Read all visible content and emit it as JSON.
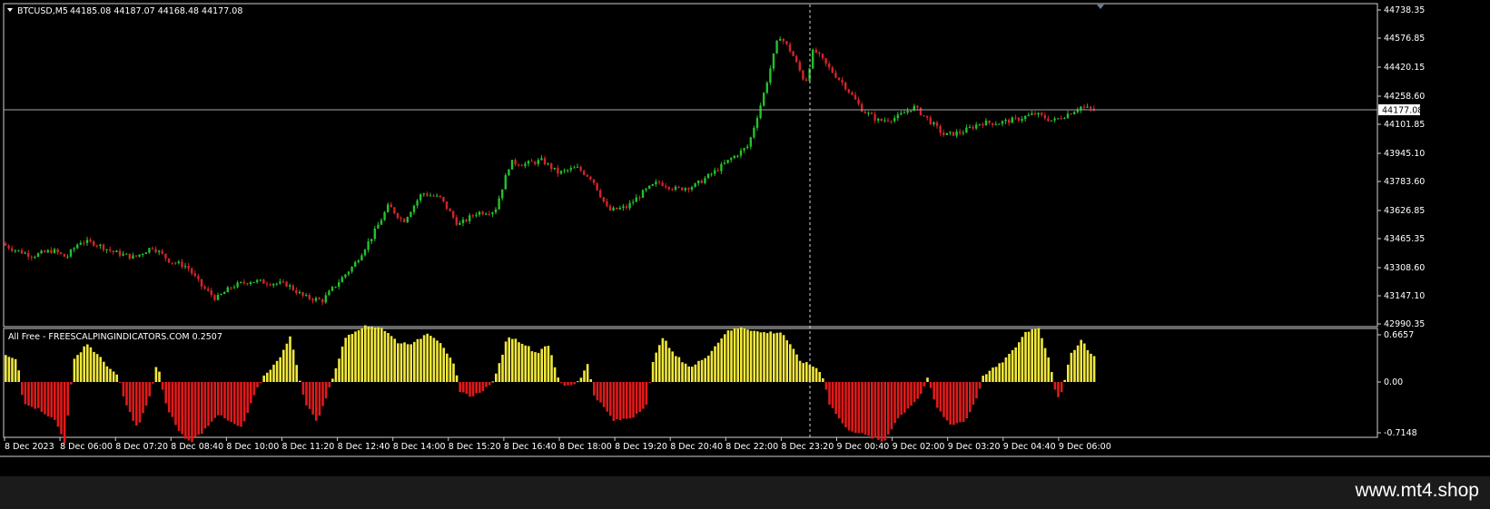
{
  "symbol_header": {
    "symbol": "BTCUSD,M5",
    "ohlc": "44185.08 44187.07 44168.48 44177.08"
  },
  "price_axis": {
    "ticks": [
      "44738.35",
      "44576.85",
      "44420.15",
      "44258.60",
      "44101.85",
      "43945.10",
      "43783.60",
      "43626.85",
      "43465.35",
      "43308.60",
      "43147.10",
      "42990.35"
    ],
    "current_price": "44177.08"
  },
  "indicator": {
    "title": "All Free - FREESCALPINGINDICATORS.COM 0.2507",
    "axis_ticks": [
      "0.6657",
      "0.00",
      "-0.7148"
    ]
  },
  "time_axis": {
    "labels": [
      "8 Dec 2023",
      "8 Dec 06:00",
      "8 Dec 07:20",
      "8 Dec 08:40",
      "8 Dec 10:00",
      "8 Dec 11:20",
      "8 Dec 12:40",
      "8 Dec 14:00",
      "8 Dec 15:20",
      "8 Dec 16:40",
      "8 Dec 18:00",
      "8 Dec 19:20",
      "8 Dec 20:40",
      "8 Dec 22:00",
      "8 Dec 23:20",
      "9 Dec 00:40",
      "9 Dec 02:00",
      "9 Dec 03:20",
      "9 Dec 04:40",
      "9 Dec 06:00"
    ]
  },
  "colors": {
    "bull": "#22c22a",
    "bear": "#d4232a",
    "hist_pos": "#f2e83a",
    "hist_neg": "#e01a1a",
    "axis": "#cfcfcf"
  },
  "price_path_anchors": [
    [
      0,
      43440
    ],
    [
      18,
      43400
    ],
    [
      36,
      43370
    ],
    [
      58,
      43400
    ],
    [
      73,
      43360
    ],
    [
      88,
      43450
    ],
    [
      104,
      43440
    ],
    [
      125,
      43390
    ],
    [
      148,
      43360
    ],
    [
      168,
      43420
    ],
    [
      187,
      43340
    ],
    [
      206,
      43310
    ],
    [
      222,
      43200
    ],
    [
      238,
      43130
    ],
    [
      256,
      43200
    ],
    [
      276,
      43230
    ],
    [
      296,
      43220
    ],
    [
      316,
      43210
    ],
    [
      335,
      43140
    ],
    [
      355,
      43120
    ],
    [
      372,
      43220
    ],
    [
      390,
      43320
    ],
    [
      410,
      43480
    ],
    [
      428,
      43650
    ],
    [
      444,
      43560
    ],
    [
      465,
      43720
    ],
    [
      485,
      43690
    ],
    [
      505,
      43540
    ],
    [
      525,
      43610
    ],
    [
      545,
      43620
    ],
    [
      562,
      43890
    ],
    [
      578,
      43880
    ],
    [
      597,
      43900
    ],
    [
      615,
      43830
    ],
    [
      635,
      43860
    ],
    [
      652,
      43800
    ],
    [
      670,
      43620
    ],
    [
      690,
      43640
    ],
    [
      710,
      43730
    ],
    [
      725,
      43780
    ],
    [
      745,
      43740
    ],
    [
      765,
      43760
    ],
    [
      785,
      43830
    ],
    [
      805,
      43910
    ],
    [
      824,
      43980
    ],
    [
      840,
      44250
    ],
    [
      858,
      44600
    ],
    [
      872,
      44500
    ],
    [
      887,
      44330
    ],
    [
      896,
      44520
    ],
    [
      912,
      44420
    ],
    [
      930,
      44320
    ],
    [
      950,
      44180
    ],
    [
      968,
      44120
    ],
    [
      988,
      44140
    ],
    [
      1006,
      44200
    ],
    [
      1022,
      44130
    ],
    [
      1040,
      44040
    ],
    [
      1060,
      44060
    ],
    [
      1080,
      44110
    ],
    [
      1100,
      44110
    ],
    [
      1120,
      44130
    ],
    [
      1140,
      44160
    ],
    [
      1160,
      44120
    ],
    [
      1180,
      44170
    ],
    [
      1190,
      44200
    ],
    [
      1207,
      44177
    ]
  ],
  "oscillator_anchors": [
    [
      0,
      0.4
    ],
    [
      18,
      0.3
    ],
    [
      24,
      -0.28
    ],
    [
      44,
      -0.4
    ],
    [
      60,
      -0.55
    ],
    [
      70,
      -0.85
    ],
    [
      80,
      0.3
    ],
    [
      94,
      0.55
    ],
    [
      112,
      0.3
    ],
    [
      130,
      0.05
    ],
    [
      136,
      -0.28
    ],
    [
      150,
      -0.65
    ],
    [
      164,
      -0.2
    ],
    [
      172,
      0.3
    ],
    [
      180,
      -0.28
    ],
    [
      196,
      -0.7
    ],
    [
      208,
      -0.85
    ],
    [
      222,
      -0.7
    ],
    [
      238,
      -0.45
    ],
    [
      250,
      -0.55
    ],
    [
      265,
      -0.65
    ],
    [
      280,
      -0.15
    ],
    [
      290,
      0.1
    ],
    [
      305,
      0.3
    ],
    [
      318,
      0.65
    ],
    [
      328,
      0.1
    ],
    [
      334,
      -0.28
    ],
    [
      348,
      -0.55
    ],
    [
      360,
      -0.15
    ],
    [
      366,
      0.1
    ],
    [
      380,
      0.65
    ],
    [
      398,
      0.78
    ],
    [
      418,
      0.78
    ],
    [
      438,
      0.55
    ],
    [
      455,
      0.55
    ],
    [
      470,
      0.7
    ],
    [
      485,
      0.55
    ],
    [
      500,
      0.2
    ],
    [
      505,
      -0.15
    ],
    [
      520,
      -0.2
    ],
    [
      538,
      -0.05
    ],
    [
      545,
      0.1
    ],
    [
      558,
      0.65
    ],
    [
      575,
      0.55
    ],
    [
      590,
      0.4
    ],
    [
      602,
      0.55
    ],
    [
      612,
      0.1
    ],
    [
      618,
      -0.05
    ],
    [
      632,
      -0.03
    ],
    [
      640,
      0.1
    ],
    [
      646,
      0.25
    ],
    [
      653,
      -0.18
    ],
    [
      675,
      -0.55
    ],
    [
      695,
      -0.5
    ],
    [
      712,
      -0.3
    ],
    [
      716,
      0.2
    ],
    [
      728,
      0.65
    ],
    [
      740,
      0.4
    ],
    [
      760,
      0.2
    ],
    [
      780,
      0.4
    ],
    [
      798,
      0.7
    ],
    [
      815,
      0.78
    ],
    [
      835,
      0.7
    ],
    [
      860,
      0.7
    ],
    [
      880,
      0.3
    ],
    [
      898,
      0.2
    ],
    [
      906,
      0.05
    ],
    [
      912,
      -0.3
    ],
    [
      930,
      -0.65
    ],
    [
      952,
      -0.75
    ],
    [
      972,
      -0.85
    ],
    [
      985,
      -0.55
    ],
    [
      1000,
      -0.35
    ],
    [
      1012,
      -0.2
    ],
    [
      1020,
      0.05
    ],
    [
      1030,
      -0.35
    ],
    [
      1045,
      -0.6
    ],
    [
      1062,
      -0.55
    ],
    [
      1075,
      -0.2
    ],
    [
      1082,
      0.1
    ],
    [
      1100,
      0.25
    ],
    [
      1115,
      0.45
    ],
    [
      1128,
      0.7
    ],
    [
      1142,
      0.78
    ],
    [
      1155,
      0.3
    ],
    [
      1160,
      -0.08
    ],
    [
      1166,
      -0.25
    ],
    [
      1172,
      0.05
    ],
    [
      1178,
      0.4
    ],
    [
      1190,
      0.6
    ],
    [
      1200,
      0.4
    ],
    [
      1208,
      0.3
    ]
  ],
  "crosshair_time_label": "8 Dec 23:20"
}
